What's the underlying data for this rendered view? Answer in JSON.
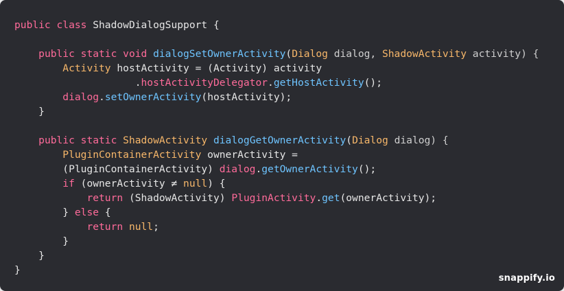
{
  "brand": "snappify.io",
  "colors": {
    "background": "#2a2b30",
    "keyword": "#ff6b9a",
    "type": "#f7b76a",
    "function": "#6ec4ff",
    "text": "#e6e6e6"
  },
  "code": {
    "lines": [
      [
        {
          "t": "kw",
          "v": "public class "
        },
        {
          "t": "plain",
          "v": "ShadowDialogSupport {"
        }
      ],
      [
        {
          "t": "plain",
          "v": ""
        }
      ],
      [
        {
          "t": "plain",
          "v": "    "
        },
        {
          "t": "kw",
          "v": "public static void "
        },
        {
          "t": "fn",
          "v": "dialogSetOwnerActivity"
        },
        {
          "t": "plain",
          "v": "("
        },
        {
          "t": "type",
          "v": "Dialog"
        },
        {
          "t": "muted",
          "v": " dialog, "
        },
        {
          "t": "type",
          "v": "ShadowActivity"
        },
        {
          "t": "muted",
          "v": " activity) {"
        }
      ],
      [
        {
          "t": "plain",
          "v": "        "
        },
        {
          "t": "type",
          "v": "Activity"
        },
        {
          "t": "plain",
          "v": " hostActivity = (Activity) activity"
        }
      ],
      [
        {
          "t": "plain",
          "v": "                    ."
        },
        {
          "t": "prop",
          "v": "hostActivityDelegator"
        },
        {
          "t": "plain",
          "v": "."
        },
        {
          "t": "fn",
          "v": "getHostActivity"
        },
        {
          "t": "plain",
          "v": "();"
        }
      ],
      [
        {
          "t": "plain",
          "v": "        "
        },
        {
          "t": "prop",
          "v": "dialog"
        },
        {
          "t": "plain",
          "v": "."
        },
        {
          "t": "fn",
          "v": "setOwnerActivity"
        },
        {
          "t": "plain",
          "v": "(hostActivity);"
        }
      ],
      [
        {
          "t": "plain",
          "v": "    }"
        }
      ],
      [
        {
          "t": "plain",
          "v": ""
        }
      ],
      [
        {
          "t": "plain",
          "v": "    "
        },
        {
          "t": "kw",
          "v": "public static "
        },
        {
          "t": "type",
          "v": "ShadowActivity"
        },
        {
          "t": "plain",
          "v": " "
        },
        {
          "t": "fn",
          "v": "dialogGetOwnerActivity"
        },
        {
          "t": "plain",
          "v": "("
        },
        {
          "t": "type",
          "v": "Dialog"
        },
        {
          "t": "muted",
          "v": " dialog) {"
        }
      ],
      [
        {
          "t": "plain",
          "v": "        "
        },
        {
          "t": "type",
          "v": "PluginContainerActivity"
        },
        {
          "t": "plain",
          "v": " ownerActivity ="
        }
      ],
      [
        {
          "t": "plain",
          "v": "        (PluginContainerActivity) "
        },
        {
          "t": "prop",
          "v": "dialog"
        },
        {
          "t": "plain",
          "v": "."
        },
        {
          "t": "fn",
          "v": "getOwnerActivity"
        },
        {
          "t": "plain",
          "v": "();"
        }
      ],
      [
        {
          "t": "plain",
          "v": "        "
        },
        {
          "t": "kw",
          "v": "if"
        },
        {
          "t": "plain",
          "v": " (ownerActivity ≠ "
        },
        {
          "t": "type",
          "v": "null"
        },
        {
          "t": "plain",
          "v": ") {"
        }
      ],
      [
        {
          "t": "plain",
          "v": "            "
        },
        {
          "t": "kw",
          "v": "return"
        },
        {
          "t": "plain",
          "v": " (ShadowActivity) "
        },
        {
          "t": "prop",
          "v": "PluginActivity"
        },
        {
          "t": "plain",
          "v": "."
        },
        {
          "t": "fn",
          "v": "get"
        },
        {
          "t": "plain",
          "v": "(ownerActivity);"
        }
      ],
      [
        {
          "t": "plain",
          "v": "        } "
        },
        {
          "t": "kw",
          "v": "else"
        },
        {
          "t": "plain",
          "v": " {"
        }
      ],
      [
        {
          "t": "plain",
          "v": "            "
        },
        {
          "t": "kw",
          "v": "return "
        },
        {
          "t": "type",
          "v": "null"
        },
        {
          "t": "plain",
          "v": ";"
        }
      ],
      [
        {
          "t": "plain",
          "v": "        }"
        }
      ],
      [
        {
          "t": "plain",
          "v": "    }"
        }
      ],
      [
        {
          "t": "plain",
          "v": "}"
        }
      ]
    ]
  }
}
